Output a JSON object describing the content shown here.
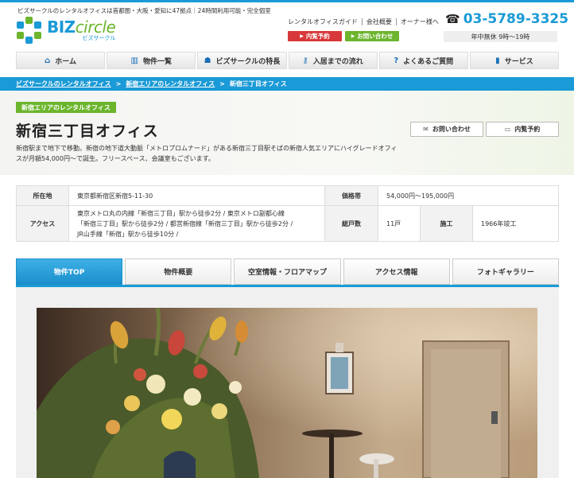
{
  "header": {
    "tagline": "ビズサークルのレンタルオフィスは首都圏・大阪・愛知に47拠点｜24時間利用可能・完全個室",
    "logo": {
      "main": "BIZ",
      "accent": "circle",
      "sub": "ビズサークル"
    },
    "links": [
      "レンタルオフィスガイド",
      "会社概要",
      "オーナー様へ"
    ],
    "reserve_btn": "内覧予約",
    "contact_btn": "お問い合わせ",
    "phone": "03-5789-3325",
    "hours": "年中無休 9時〜19時"
  },
  "nav": [
    {
      "label": "ホーム",
      "icon": "home-icon",
      "glyph": "⌂"
    },
    {
      "label": "物件一覧",
      "icon": "buildings-icon",
      "glyph": "▥"
    },
    {
      "label": "ビズサークルの特長",
      "icon": "person-icon",
      "glyph": "☗"
    },
    {
      "label": "入居までの流れ",
      "icon": "key-icon",
      "glyph": "⚷"
    },
    {
      "label": "よくあるご質問",
      "icon": "question-icon",
      "glyph": "?"
    },
    {
      "label": "サービス",
      "icon": "book-icon",
      "glyph": "▮"
    }
  ],
  "breadcrumb": [
    "ビズサークルのレンタルオフィス",
    "新宿エリアのレンタルオフィス",
    "新宿三丁目オフィス"
  ],
  "breadcrumb_sep": ">",
  "hero": {
    "area_tag": "新宿エリアのレンタルオフィス",
    "title": "新宿三丁目オフィス",
    "lead": "新宿駅まで地下で移動。新宿の地下道大動脈「メトロプロムナード」がある新宿三丁目駅そばの新宿人気エリアにハイグレードオフィスが月額54,000円〜で誕生。フリースペース、会議室もございます。",
    "contact_btn": "お問い合わせ",
    "reserve_btn": "内覧予約"
  },
  "info": {
    "address_label": "所在地",
    "address": "東京都新宿区新宿5-11-30",
    "price_label": "価格帯",
    "price": "54,000円〜195,000円",
    "access_label": "アクセス",
    "access": [
      "東京メトロ丸の内線「新宿三丁目」駅から徒歩2分 / 東京メトロ副都心線",
      "「新宿三丁目」駅から徒歩2分 / 都営新宿線「新宿三丁目」駅から徒歩2分 /",
      "JR山手線「新宿」駅から徒歩10分 /"
    ],
    "units_label": "総戸数",
    "units": "11戸",
    "built_label": "施工",
    "built": "1966年竣工"
  },
  "tabs": [
    "物件TOP",
    "物件概要",
    "空室情報・フロアマップ",
    "アクセス情報",
    "フォトギャラリー"
  ],
  "active_tab": 0,
  "colors": {
    "brand_blue": "#1a9ad6",
    "brand_green": "#6cb52d",
    "reserve_red": "#d9383a"
  }
}
